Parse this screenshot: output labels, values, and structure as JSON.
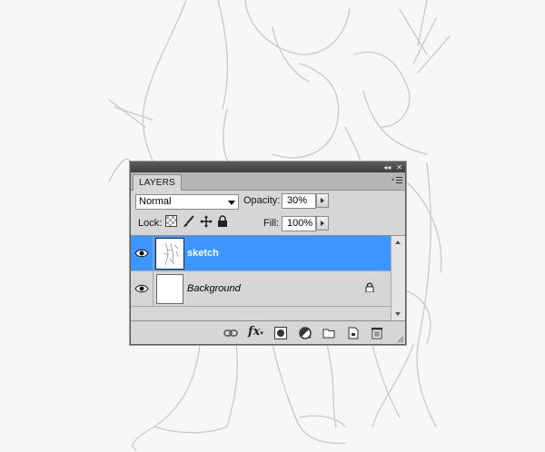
{
  "panel": {
    "tab_label": "LAYERS",
    "titlebar_buttons": [
      "collapse-icon",
      "close-icon"
    ],
    "blend_mode": "Normal",
    "opacity_label": "Opacity:",
    "opacity_value": "30%",
    "lock_label": "Lock:",
    "fill_label": "Fill:",
    "fill_value": "100%",
    "layers": [
      {
        "name": "sketch",
        "selected": true,
        "visible": true
      },
      {
        "name": "Background",
        "selected": false,
        "visible": true,
        "locked": true
      }
    ],
    "footer_icons": [
      "link-layers-icon",
      "fx-icon",
      "add-mask-icon",
      "adjustment-layer-icon",
      "new-group-icon",
      "new-layer-icon",
      "delete-layer-icon"
    ],
    "fx_label": "fx"
  },
  "colors": {
    "selection": "#3d95ff",
    "panel_bg": "#d6d6d6",
    "titlebar": "#3e3e3e"
  }
}
